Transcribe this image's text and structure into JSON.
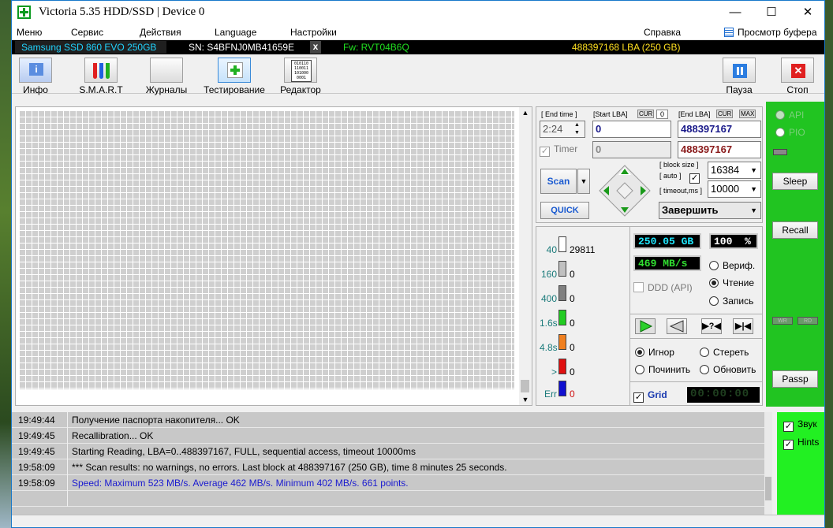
{
  "window": {
    "title": "Victoria 5.35 HDD/SSD | Device 0",
    "minimize": "—",
    "maximize": "☐",
    "close": "✕"
  },
  "menu": {
    "items": [
      "Меню",
      "Сервис",
      "Действия",
      "Language",
      "Настройки"
    ],
    "help": "Справка",
    "buffer": "Просмотр буфера"
  },
  "device": {
    "model": "Samsung SSD 860 EVO 250GB",
    "serial": "SN: S4BFNJ0MB41659E",
    "close": "x",
    "firmware": "Fw: RVT04B6Q",
    "lba": "488397168 LBA (250 GB)"
  },
  "toolbar": {
    "info": "Инфо",
    "smart": "S.M.A.R.T",
    "journals": "Журналы",
    "testing": "Тестирование",
    "editor": "Редактор",
    "pause": "Пауза",
    "stop": "Стоп",
    "editor_icon_text": "010110\n110011\n101000\n0001"
  },
  "scan": {
    "end_time_label": "[ End time ]",
    "start_lba_label": "[Start LBA]",
    "cur": "CUR",
    "cur_val": "0",
    "end_lba_label": "[End LBA]",
    "cur2": "CUR",
    "max": "MAX",
    "end_time": "2:24",
    "start_lba": "0",
    "end_lba": "488397167",
    "timer_label": "Timer",
    "timer_val": "0",
    "end_lba2": "488397167",
    "block_size_label": "[ block size ]",
    "auto_label": "[ auto ]",
    "block_size": "16384",
    "timeout_label": "[ timeout,ms ]",
    "timeout": "10000",
    "scan_btn": "Scan",
    "quick_btn": "QUICK",
    "finish": "Завершить"
  },
  "stats": {
    "rows": [
      {
        "label": "40",
        "count": "29811",
        "color": "#ffffff"
      },
      {
        "label": "160",
        "count": "0",
        "color": "#c0c0c0"
      },
      {
        "label": "400",
        "count": "0",
        "color": "#808080"
      },
      {
        "label": "1.6s",
        "count": "0",
        "color": "#22cc22"
      },
      {
        "label": "4.8s",
        "count": "0",
        "color": "#f08020"
      },
      {
        "label": ">",
        "count": "0",
        "color": "#e01010"
      },
      {
        "label": "Err",
        "count": "0",
        "color": "#1010d0"
      }
    ],
    "size": "250.05 GB",
    "percent": "100",
    "pct": "%",
    "speed": "469 MB/s",
    "ddd": "DDD (API)",
    "verify": "Вериф.",
    "read": "Чтение",
    "write": "Запись",
    "ignore": "Игнор",
    "erase": "Стереть",
    "repair": "Починить",
    "refresh": "Обновить",
    "grid": "Grid",
    "timer": "00:00:00"
  },
  "side": {
    "api": "API",
    "pio": "PIO",
    "sleep": "Sleep",
    "recall": "Recall",
    "wr": "WR",
    "rd": "RD",
    "passp": "Passp",
    "sound": "Звук",
    "hints": "Hints"
  },
  "log": [
    {
      "time": "19:49:44",
      "msg": "Получение паспорта накопителя... OK",
      "color": "#000"
    },
    {
      "time": "19:49:45",
      "msg": "Recallibration... OK",
      "color": "#000"
    },
    {
      "time": "19:49:45",
      "msg": "Starting Reading, LBA=0..488397167, FULL, sequential access, timeout 10000ms",
      "color": "#000"
    },
    {
      "time": "19:58:09",
      "msg": "*** Scan results: no warnings, no errors. Last block at 488397167 (250 GB), time 8 minutes 25 seconds.",
      "color": "#000"
    },
    {
      "time": "19:58:09",
      "msg": "Speed: Maximum 523 MB/s. Average 462 MB/s. Minimum 402 MB/s. 661 points.",
      "color": "#1a1ad0"
    }
  ]
}
